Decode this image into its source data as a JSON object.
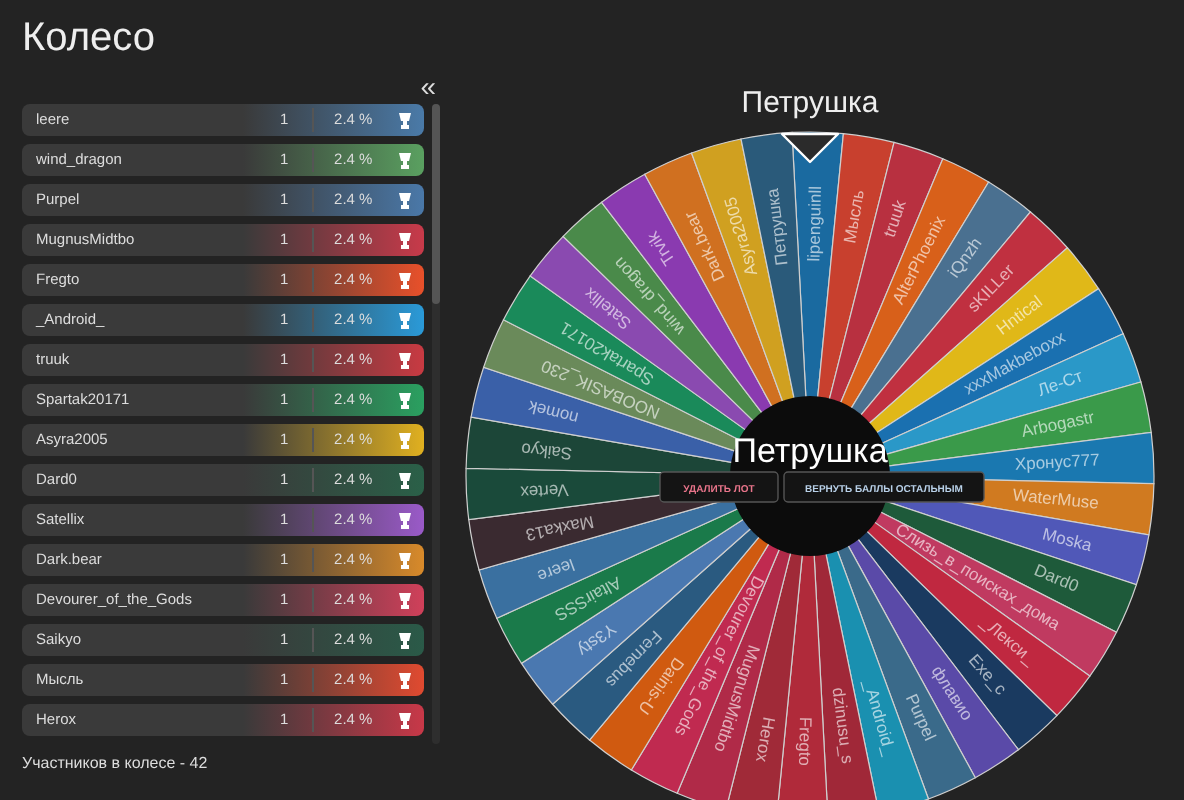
{
  "title": "Колесо",
  "collapse_button": "«",
  "participants": [
    {
      "name": "leere",
      "count": "1",
      "percent": "2.4 %",
      "color": "#4a7aa8"
    },
    {
      "name": "wind_dragon",
      "count": "1",
      "percent": "2.4 %",
      "color": "#5aa060"
    },
    {
      "name": "Purpel",
      "count": "1",
      "percent": "2.4 %",
      "color": "#4a78a8"
    },
    {
      "name": "MugnusMidtbo",
      "count": "1",
      "percent": "2.4 %",
      "color": "#c83a4a"
    },
    {
      "name": "Fregto",
      "count": "1",
      "percent": "2.4 %",
      "color": "#e8502a"
    },
    {
      "name": "_Android_",
      "count": "1",
      "percent": "2.4 %",
      "color": "#2a9ad8"
    },
    {
      "name": "truuk",
      "count": "1",
      "percent": "2.4 %",
      "color": "#c83a42"
    },
    {
      "name": "Spartak20171",
      "count": "1",
      "percent": "2.4 %",
      "color": "#2aa060"
    },
    {
      "name": "Asyra2005",
      "count": "1",
      "percent": "2.4 %",
      "color": "#e0b020"
    },
    {
      "name": "Dard0",
      "count": "1",
      "percent": "2.4 %",
      "color": "#2a6048"
    },
    {
      "name": "Satellix",
      "count": "1",
      "percent": "2.4 %",
      "color": "#9a5ac8"
    },
    {
      "name": "Dark.bear",
      "count": "1",
      "percent": "2.4 %",
      "color": "#d88a2a"
    },
    {
      "name": "Devourer_of_the_Gods",
      "count": "1",
      "percent": "2.4 %",
      "color": "#d0405a"
    },
    {
      "name": "Saikyo",
      "count": "1",
      "percent": "2.4 %",
      "color": "#2a5a48"
    },
    {
      "name": "Мысль",
      "count": "1",
      "percent": "2.4 %",
      "color": "#e04a30"
    },
    {
      "name": "Herox",
      "count": "1",
      "percent": "2.4 %",
      "color": "#c83848"
    }
  ],
  "footer": "Участников в колесе - 42",
  "wheel": {
    "winner": "Петрушка",
    "center_label": "Петрушка",
    "buttons": [
      {
        "label": "УДАЛИТЬ ЛОТ",
        "kind": "danger"
      },
      {
        "label": "ВЕРНУТЬ БАЛЛЫ ОСТАЛЬНЫМ",
        "kind": "neutral"
      }
    ],
    "slices": [
      {
        "name": "lipenguinll",
        "color": "#1a6aa0"
      },
      {
        "name": "Мысль",
        "color": "#c8402e"
      },
      {
        "name": "truuk",
        "color": "#b83040"
      },
      {
        "name": "AlterPhoenix",
        "color": "#d8601a"
      },
      {
        "name": "iQnzh",
        "color": "#4a7090"
      },
      {
        "name": "sKILLer",
        "color": "#c03040"
      },
      {
        "name": "Hntical",
        "color": "#e0b818"
      },
      {
        "name": "xxxMakbeboxx",
        "color": "#1a70b0"
      },
      {
        "name": "Ле-Ст",
        "color": "#2a98c8"
      },
      {
        "name": "Arbogastr",
        "color": "#3a9a4a"
      },
      {
        "name": "Хронус777",
        "color": "#1a78b0"
      },
      {
        "name": "WaterMuse",
        "color": "#d07a20"
      },
      {
        "name": "Moska",
        "color": "#5058b8"
      },
      {
        "name": "Dard0",
        "color": "#1e5a3a"
      },
      {
        "name": "Слизь_в_поисках_дома",
        "color": "#c03a60"
      },
      {
        "name": "_Лекси_",
        "color": "#c02840"
      },
      {
        "name": "Exe_c",
        "color": "#1a3a60"
      },
      {
        "name": "флавио",
        "color": "#5a4aa8"
      },
      {
        "name": "Purpel",
        "color": "#3a6a8a"
      },
      {
        "name": "_Android_",
        "color": "#1a90b0"
      },
      {
        "name": "dzinusu_s",
        "color": "#a02838"
      },
      {
        "name": "Fregto",
        "color": "#b02a3a"
      },
      {
        "name": "Herox",
        "color": "#a02a38"
      },
      {
        "name": "MugnusMidtbo",
        "color": "#b02a48"
      },
      {
        "name": "Devourer_of_the_Gods",
        "color": "#c02a50"
      },
      {
        "name": "Dainis-U",
        "color": "#d05a10"
      },
      {
        "name": "Fernebus",
        "color": "#2a5a80"
      },
      {
        "name": "Y3sty",
        "color": "#4a78b0"
      },
      {
        "name": "AltairSSS",
        "color": "#1a7a4a"
      },
      {
        "name": "leere",
        "color": "#3a70a0"
      },
      {
        "name": "Maxka13",
        "color": "#3a2a30"
      },
      {
        "name": "Vertex",
        "color": "#1a4a3a"
      },
      {
        "name": "Saikyo",
        "color": "#1c4638"
      },
      {
        "name": "nomek",
        "color": "#3a60a8"
      },
      {
        "name": "NOOBASIK_230",
        "color": "#6a8a5a"
      },
      {
        "name": "Spartak20171",
        "color": "#1a8a5a"
      },
      {
        "name": "Satellix",
        "color": "#8a4ab0"
      },
      {
        "name": "wind_dragon",
        "color": "#4a8a4a"
      },
      {
        "name": "Trvik",
        "color": "#8a3ab0"
      },
      {
        "name": "Dark.bear",
        "color": "#d07020"
      },
      {
        "name": "Asyra2005",
        "color": "#d0a020"
      },
      {
        "name": "Петрушка",
        "color": "#2a5a7a"
      }
    ]
  }
}
